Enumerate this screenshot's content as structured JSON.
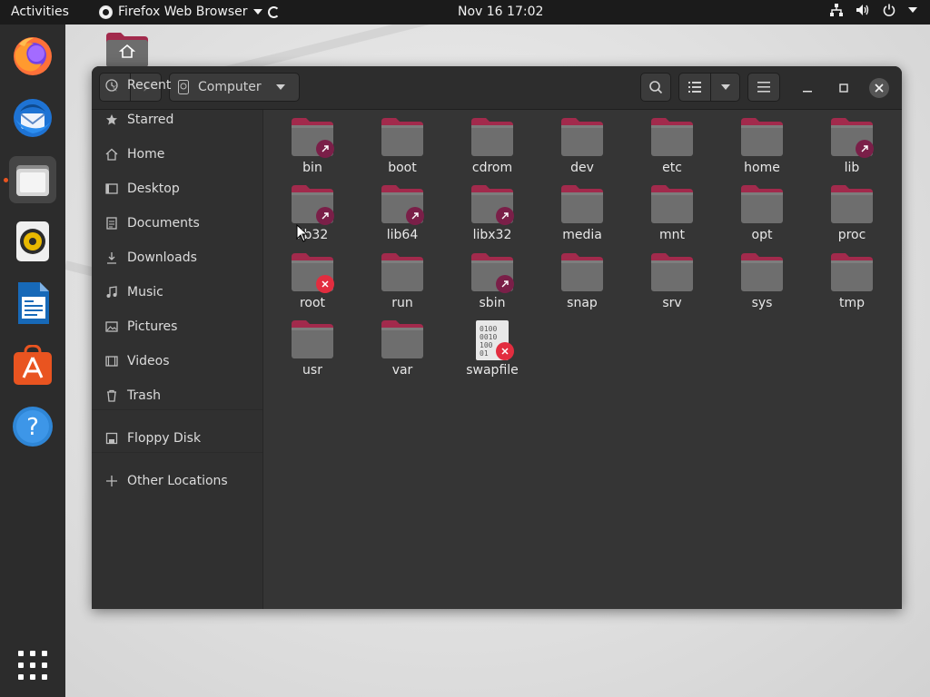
{
  "top_bar": {
    "activities": "Activities",
    "app_name": "Firefox Web Browser",
    "clock": "Nov 16  17:02",
    "status_icons": [
      "network-icon",
      "volume-icon",
      "power-icon",
      "chevron-down-icon"
    ]
  },
  "dock": {
    "items": [
      {
        "name": "firefox",
        "icon": "firefox-icon",
        "running": false
      },
      {
        "name": "thunderbird",
        "icon": "thunderbird-icon",
        "running": false
      },
      {
        "name": "files",
        "icon": "files-icon",
        "running": true
      },
      {
        "name": "rhythmbox",
        "icon": "rhythmbox-icon",
        "running": false
      },
      {
        "name": "libreoffice-writer",
        "icon": "writer-icon",
        "running": false
      },
      {
        "name": "ubuntu-software",
        "icon": "software-icon",
        "running": false
      },
      {
        "name": "help",
        "icon": "help-icon",
        "running": false
      }
    ],
    "show_apps_icon": "grid-icon"
  },
  "window": {
    "location": "Computer",
    "nav": {
      "back": "‹",
      "forward": "›"
    },
    "sidebar": {
      "items": [
        {
          "label": "Recent",
          "icon": "clock-icon"
        },
        {
          "label": "Starred",
          "icon": "star-icon"
        },
        {
          "label": "Home",
          "icon": "home-icon"
        },
        {
          "label": "Desktop",
          "icon": "desktop-icon"
        },
        {
          "label": "Documents",
          "icon": "document-icon"
        },
        {
          "label": "Downloads",
          "icon": "download-icon"
        },
        {
          "label": "Music",
          "icon": "music-icon"
        },
        {
          "label": "Pictures",
          "icon": "picture-icon"
        },
        {
          "label": "Videos",
          "icon": "video-icon"
        },
        {
          "label": "Trash",
          "icon": "trash-icon"
        },
        {
          "label": "Floppy Disk",
          "icon": "floppy-icon"
        },
        {
          "label": "Other Locations",
          "icon": "plus-icon"
        }
      ]
    },
    "files": [
      {
        "name": "bin",
        "type": "folder",
        "emblem": "symlink"
      },
      {
        "name": "boot",
        "type": "folder",
        "emblem": ""
      },
      {
        "name": "cdrom",
        "type": "folder",
        "emblem": ""
      },
      {
        "name": "dev",
        "type": "folder",
        "emblem": ""
      },
      {
        "name": "etc",
        "type": "folder",
        "emblem": ""
      },
      {
        "name": "home",
        "type": "folder",
        "emblem": ""
      },
      {
        "name": "lib",
        "type": "folder",
        "emblem": "symlink"
      },
      {
        "name": "lib32",
        "type": "folder",
        "emblem": "symlink"
      },
      {
        "name": "lib64",
        "type": "folder",
        "emblem": "symlink"
      },
      {
        "name": "libx32",
        "type": "folder",
        "emblem": "symlink"
      },
      {
        "name": "media",
        "type": "folder",
        "emblem": ""
      },
      {
        "name": "mnt",
        "type": "folder",
        "emblem": ""
      },
      {
        "name": "opt",
        "type": "folder",
        "emblem": ""
      },
      {
        "name": "proc",
        "type": "folder",
        "emblem": ""
      },
      {
        "name": "root",
        "type": "folder",
        "emblem": "locked"
      },
      {
        "name": "run",
        "type": "folder",
        "emblem": ""
      },
      {
        "name": "sbin",
        "type": "folder",
        "emblem": "symlink"
      },
      {
        "name": "snap",
        "type": "folder",
        "emblem": ""
      },
      {
        "name": "srv",
        "type": "folder",
        "emblem": ""
      },
      {
        "name": "sys",
        "type": "folder",
        "emblem": ""
      },
      {
        "name": "tmp",
        "type": "folder",
        "emblem": ""
      },
      {
        "name": "usr",
        "type": "folder",
        "emblem": ""
      },
      {
        "name": "var",
        "type": "folder",
        "emblem": ""
      },
      {
        "name": "swapfile",
        "type": "binary",
        "emblem": "locked",
        "preview_lines": [
          "0100",
          "0010",
          "100",
          "01"
        ]
      }
    ]
  },
  "colors": {
    "accent": "#e95420",
    "folder_tab": "#a22a4c",
    "folder_body": "#6e6e6e",
    "symlink_emblem": "#7a1f48",
    "locked_emblem": "#e22d3f"
  }
}
